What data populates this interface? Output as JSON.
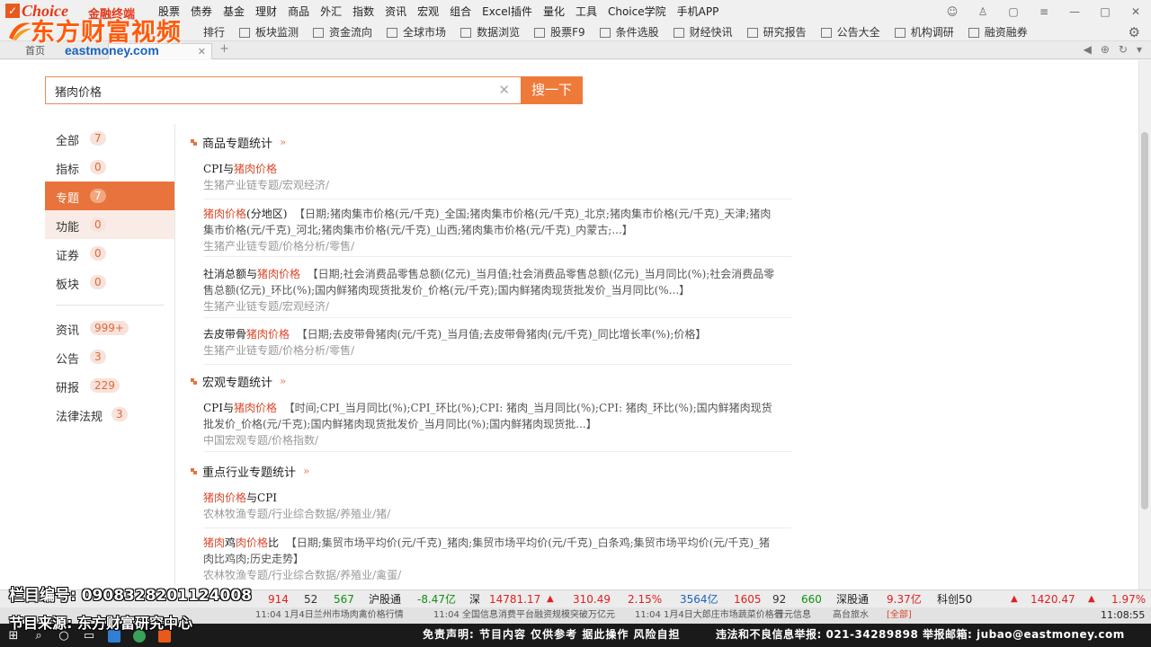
{
  "app": {
    "logo_brand": "Choice",
    "logo_cn": "金融终端",
    "main_menu": [
      "股票",
      "债券",
      "基金",
      "理财",
      "商品",
      "外汇",
      "指数",
      "资讯",
      "宏观",
      "组合",
      "Excel插件",
      "量化",
      "工具",
      "Choice学院",
      "手机APP"
    ],
    "toolbar": [
      "排行",
      "板块监测",
      "资金流向",
      "全球市场",
      "数据浏览",
      "股票F9",
      "条件选股",
      "财经快讯",
      "研究报告",
      "公告大全",
      "机构调研",
      "融资融券"
    ],
    "tab_home": "首页",
    "tab_close": "✕",
    "tab_add": "+"
  },
  "watermark": {
    "title": "东方财富视频",
    "site": "eastmoney.com"
  },
  "search": {
    "value": "猪肉价格",
    "clear": "✕",
    "button": "搜一下"
  },
  "categories": [
    {
      "label": "全部",
      "count": "7"
    },
    {
      "label": "指标",
      "count": "0"
    },
    {
      "label": "专题",
      "count": "7"
    },
    {
      "label": "功能",
      "count": "0"
    },
    {
      "label": "证券",
      "count": "0"
    },
    {
      "label": "板块",
      "count": "0"
    },
    {
      "label": "资讯",
      "count": "999+"
    },
    {
      "label": "公告",
      "count": "3"
    },
    {
      "label": "研报",
      "count": "229"
    },
    {
      "label": "法律法规",
      "count": "3"
    }
  ],
  "sections": [
    {
      "title": "商品专题统计",
      "more": "»",
      "items": [
        {
          "title_pre": "CPI与",
          "title_hl": "猪肉价格",
          "title_post": "",
          "desc": "",
          "path": "生猪产业链专题/宏观经济/"
        },
        {
          "title_pre": "",
          "title_hl": "猪肉价格",
          "title_post": "(分地区)",
          "desc": "【日期;猪肉集市价格(元/千克)_全国;猪肉集市价格(元/千克)_北京;猪肉集市价格(元/千克)_天津;猪肉集市价格(元/千克)_河北;猪肉集市价格(元/千克)_山西;猪肉集市价格(元/千克)_内蒙古;...】",
          "path": "生猪产业链专题/价格分析/零售/"
        },
        {
          "title_pre": "社消总额与",
          "title_hl": "猪肉价格",
          "title_post": "",
          "desc": "【日期;社会消费品零售总额(亿元)_当月值;社会消费品零售总额(亿元)_当月同比(%);社会消费品零售总额(亿元)_环比(%);国内鲜猪肉现货批发价_价格(元/千克);国内鲜猪肉现货批发价_当月同比(%...】",
          "path": "生猪产业链专题/宏观经济/"
        },
        {
          "title_pre": "去皮带骨",
          "title_hl": "猪肉价格",
          "title_post": "",
          "desc": "【日期;去皮带骨猪肉(元/千克)_当月值;去皮带骨猪肉(元/千克)_同比增长率(%);价格】",
          "path": "生猪产业链专题/价格分析/零售/"
        }
      ]
    },
    {
      "title": "宏观专题统计",
      "more": "»",
      "items": [
        {
          "title_pre": "CPI与",
          "title_hl": "猪肉价格",
          "title_post": "",
          "desc": "【时间;CPI_当月同比(%);CPI_环比(%);CPI: 猪肉_当月同比(%);CPI: 猪肉_环比(%);国内鲜猪肉现货批发价_价格(元/千克);国内鲜猪肉现货批发价_当月同比(%);国内鲜猪肉现货批...】",
          "path": "中国宏观专题/价格指数/"
        }
      ]
    },
    {
      "title": "重点行业专题统计",
      "more": "»",
      "items": [
        {
          "title_pre": "",
          "title_hl": "猪肉价格",
          "title_post": "与CPI",
          "desc": "",
          "path": "农林牧渔专题/行业综合数据/养殖业/猪/"
        },
        {
          "title_pre": "",
          "title_hl": "猪肉",
          "title_mid": "鸡",
          "title_hl2": "肉价格",
          "title_post": "比",
          "desc": "【日期;集贸市场平均价(元/千克)_猪肉;集贸市场平均价(元/千克)_白条鸡;集贸市场平均价(元/千克)_猪肉比鸡肉;历史走势】",
          "path": "农林牧渔专题/行业综合数据/养殖业/禽蛋/"
        }
      ]
    }
  ],
  "ticker": {
    "v1": "914",
    "v2": "52",
    "v3": "567",
    "sh_label": "沪股通",
    "sh_val": "-8.47亿",
    "sz_label": "深",
    "sz_index": "14781.17",
    "sz_arrow": "▲",
    "sz_chg": "310.49",
    "sz_pct": "2.15%",
    "sz_amt": "3564亿",
    "n1": "1605",
    "n2": "92",
    "n3": "660",
    "szt_label": "深股通",
    "szt_val": "9.37亿",
    "cyb_label": "科创50",
    "cyb_arrow": "▲",
    "cyb_index": "1420.47",
    "cyb_arrow2": "▲",
    "cyb_pct": "1.97%"
  },
  "news": {
    "n1": "11:04 1月4日兰州市场肉禽价格行情",
    "n2": "11:04 全国信息消费平台融资规模突破万亿元",
    "n3": "11:04 1月4日大郎庄市场蔬菜价格行",
    "n4": "普元信息",
    "n5": "高台旅水",
    "n6": "[全部]",
    "time": "11:08:55"
  },
  "overlay": {
    "code": "栏目编号: 0908328201124008",
    "source": "节目来源: 东方财富研究中心",
    "disclaimer_1": "免责声明:  节目内容 仅供参考 据此操作 风险自担",
    "disclaimer_2": "违法和不良信息举报: 021-34289898  举报邮箱: jubao@eastmoney.com"
  },
  "colors": {
    "accent": "#e8733d",
    "highlight": "#d9482b",
    "up": "#e02020",
    "down": "#109010"
  }
}
